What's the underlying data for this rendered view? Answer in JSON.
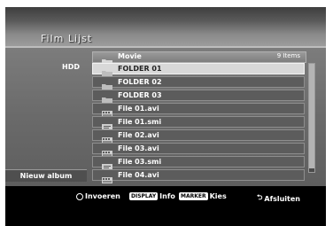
{
  "title": "Film Lijst",
  "left_panel": {
    "drive": "HDD",
    "new_album": "Nieuw album"
  },
  "list": {
    "folder": "Movie",
    "count": "9 Items",
    "items": [
      {
        "name": "FOLDER 01",
        "icon": "folder-icon",
        "selected": true
      },
      {
        "name": "FOLDER 02",
        "icon": "folder-icon",
        "selected": false
      },
      {
        "name": "FOLDER 03",
        "icon": "folder-icon",
        "selected": false
      },
      {
        "name": "File 01.avi",
        "icon": "video-file-icon",
        "selected": false
      },
      {
        "name": "File 01.smi",
        "icon": "subtitle-file-icon",
        "selected": false
      },
      {
        "name": "File 02.avi",
        "icon": "video-file-icon",
        "selected": false
      },
      {
        "name": "File 03.avi",
        "icon": "video-file-icon",
        "selected": false
      },
      {
        "name": "File 03.smi",
        "icon": "subtitle-file-icon",
        "selected": false
      },
      {
        "name": "File 04.avi",
        "icon": "video-file-icon",
        "selected": false
      }
    ]
  },
  "footer": {
    "enter": "Invoeren",
    "display_key": "DISPLAY",
    "info": "Info",
    "marker_key": "MARKER",
    "select": "Kies",
    "exit": "Afsluiten"
  }
}
